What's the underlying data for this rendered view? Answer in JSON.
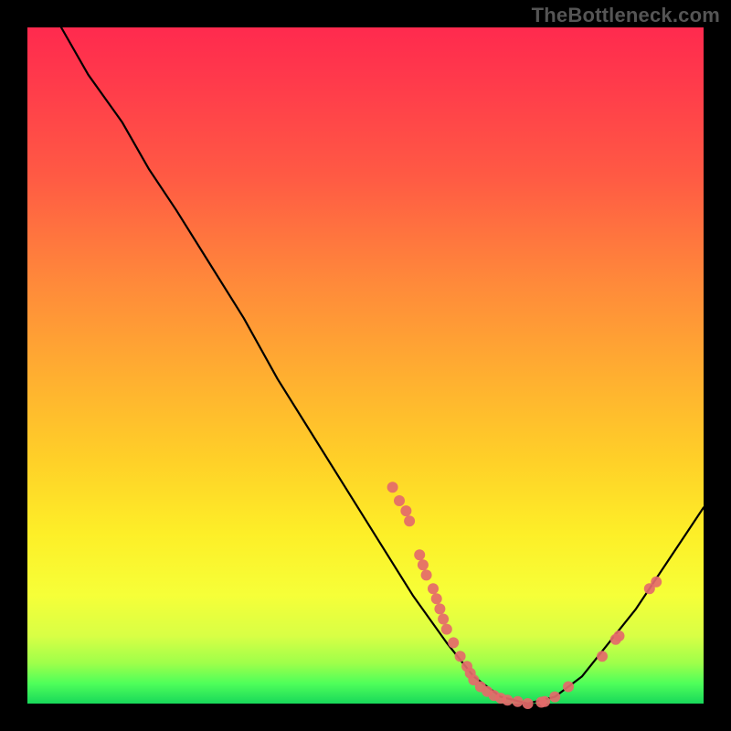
{
  "watermark": "TheBottleneck.com",
  "chart_data": {
    "type": "line",
    "title": "",
    "xlabel": "",
    "ylabel": "",
    "xlim": [
      0,
      100
    ],
    "ylim": [
      0,
      100
    ],
    "curve": [
      {
        "x": 5,
        "y": 100
      },
      {
        "x": 9,
        "y": 93
      },
      {
        "x": 14,
        "y": 86
      },
      {
        "x": 18,
        "y": 79
      },
      {
        "x": 22,
        "y": 73
      },
      {
        "x": 27,
        "y": 65
      },
      {
        "x": 32,
        "y": 57
      },
      {
        "x": 37,
        "y": 48
      },
      {
        "x": 42,
        "y": 40
      },
      {
        "x": 47,
        "y": 32
      },
      {
        "x": 52,
        "y": 24
      },
      {
        "x": 57,
        "y": 16
      },
      {
        "x": 62,
        "y": 9
      },
      {
        "x": 66,
        "y": 4
      },
      {
        "x": 70,
        "y": 1
      },
      {
        "x": 74,
        "y": 0
      },
      {
        "x": 78,
        "y": 1
      },
      {
        "x": 82,
        "y": 4
      },
      {
        "x": 86,
        "y": 9
      },
      {
        "x": 90,
        "y": 14
      },
      {
        "x": 94,
        "y": 20
      },
      {
        "x": 98,
        "y": 26
      },
      {
        "x": 100,
        "y": 29
      }
    ],
    "scatter": [
      {
        "x": 54,
        "y": 32
      },
      {
        "x": 55,
        "y": 30
      },
      {
        "x": 56,
        "y": 28.5
      },
      {
        "x": 56.5,
        "y": 27
      },
      {
        "x": 58,
        "y": 22
      },
      {
        "x": 58.5,
        "y": 20.5
      },
      {
        "x": 59,
        "y": 19
      },
      {
        "x": 60,
        "y": 17
      },
      {
        "x": 60.5,
        "y": 15.5
      },
      {
        "x": 61,
        "y": 14
      },
      {
        "x": 61.5,
        "y": 12.5
      },
      {
        "x": 62,
        "y": 11
      },
      {
        "x": 63,
        "y": 9
      },
      {
        "x": 64,
        "y": 7
      },
      {
        "x": 65,
        "y": 5.5
      },
      {
        "x": 65.5,
        "y": 4.5
      },
      {
        "x": 66,
        "y": 3.5
      },
      {
        "x": 67,
        "y": 2.5
      },
      {
        "x": 68,
        "y": 1.8
      },
      {
        "x": 69,
        "y": 1.2
      },
      {
        "x": 70,
        "y": 0.8
      },
      {
        "x": 71,
        "y": 0.5
      },
      {
        "x": 72.5,
        "y": 0.3
      },
      {
        "x": 74,
        "y": 0
      },
      {
        "x": 76,
        "y": 0.2
      },
      {
        "x": 76.5,
        "y": 0.3
      },
      {
        "x": 78,
        "y": 1
      },
      {
        "x": 80,
        "y": 2.5
      },
      {
        "x": 85,
        "y": 7
      },
      {
        "x": 87,
        "y": 9.5
      },
      {
        "x": 87.5,
        "y": 10
      },
      {
        "x": 92,
        "y": 17
      },
      {
        "x": 93,
        "y": 18
      }
    ],
    "colors": {
      "curve_stroke": "#000000",
      "scatter_fill": "#e46a6a",
      "background_black": "#000000"
    }
  }
}
